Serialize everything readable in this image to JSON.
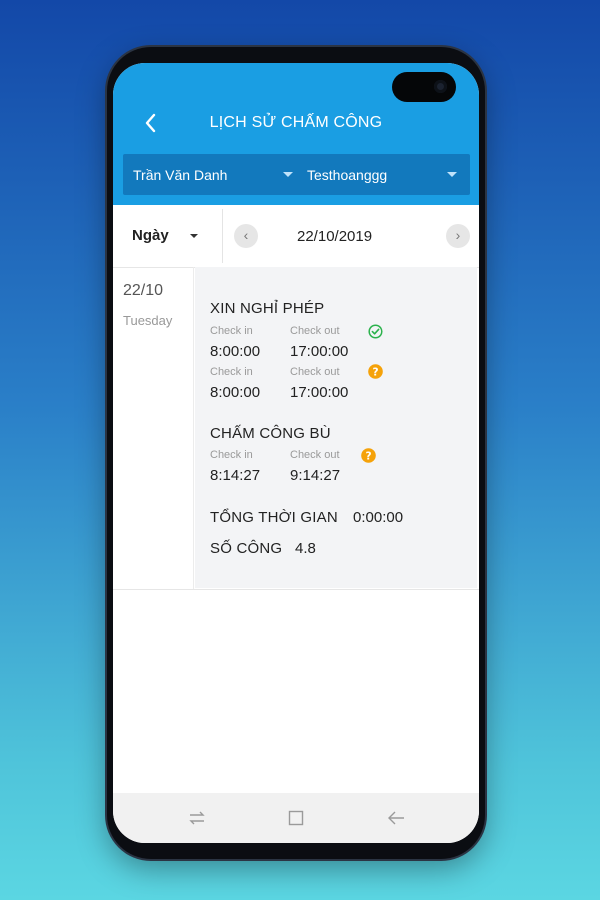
{
  "header": {
    "title": "LỊCH SỬ CHẤM CÔNG",
    "employee_select": "Trần Văn Danh",
    "company_select": "Testhoanggg"
  },
  "toolbar": {
    "period": "Ngày",
    "prev_icon": "‹",
    "next_icon": "›",
    "date": "22/10/2019"
  },
  "day": {
    "date": "22/10",
    "weekday": "Tuesday"
  },
  "sections": {
    "leave": {
      "title": "XIN NGHỈ PHÉP",
      "rows": [
        {
          "in_label": "Check in",
          "in_value": "8:00:00",
          "out_label": "Check out",
          "out_value": "17:00:00",
          "status": "check-circle-icon"
        },
        {
          "in_label": "Check in",
          "in_value": "8:00:00",
          "out_label": "Check out",
          "out_value": "17:00:00",
          "status": "question-circle-icon"
        }
      ]
    },
    "makeup": {
      "title": "CHẤM CÔNG BÙ",
      "rows": [
        {
          "in_label": "Check in",
          "in_value": "8:14:27",
          "out_label": "Check out",
          "out_value": "9:14:27",
          "status": "question-circle-icon"
        }
      ]
    }
  },
  "summary": {
    "total_label": "TỔNG THỜI GIAN",
    "total_value": "0:00:00",
    "workdays_label": "SỐ CÔNG",
    "workdays_value": "4.8"
  },
  "colors": {
    "header": "#1a9ee3",
    "filter_bar": "#1279bd",
    "approved": "#2bb24c",
    "pending": "#f5a20a"
  }
}
